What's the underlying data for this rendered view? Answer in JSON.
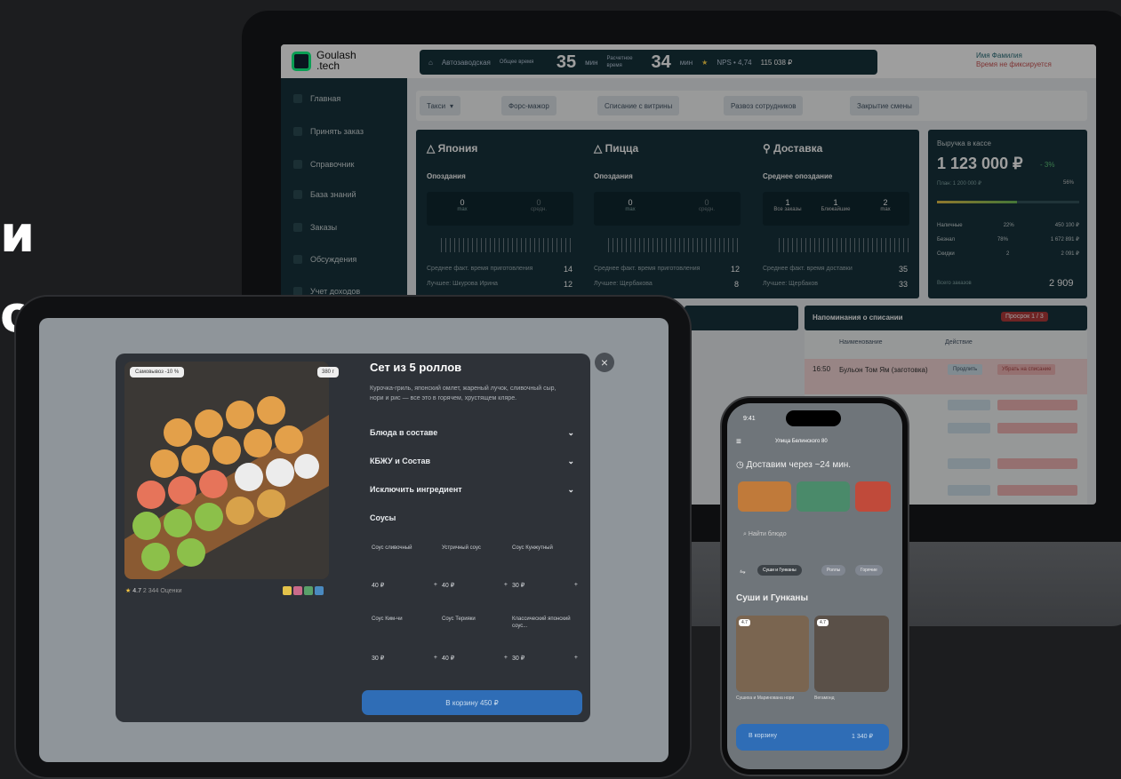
{
  "headline": {
    "line1": "и",
    "line2": "ов"
  },
  "app": {
    "logo_text_1": "Goulash",
    "logo_text_2": ".tech",
    "stats": {
      "location": "Автозаводская",
      "avg_order_label": "Общее время",
      "avg_order_value": "35",
      "avg_order_unit": "мин",
      "cook_label": "Расчетное время",
      "cook_value": "34",
      "cook_unit": "мин",
      "nps": "NPS • 4,74",
      "revenue": "115 038 ₽"
    },
    "user": {
      "name": "Имя Фамилия",
      "status": "Время не фиксируется"
    },
    "sidebar": [
      "Главная",
      "Принять заказ",
      "Справочник",
      "База знаний",
      "Заказы",
      "Обсуждения",
      "Учет доходов"
    ],
    "toolbar": [
      "Такси",
      "Форс-мажор",
      "Списание с витрины",
      "Развоз сотрудников",
      "Закрытие смены"
    ],
    "panels": [
      {
        "title": "Япония",
        "sub": "Опоздания",
        "stats": [
          {
            "v": "0",
            "l": "max"
          },
          {
            "v": "0",
            "l": "средн."
          }
        ],
        "row1_label": "Среднее факт. время приготовления",
        "row1_value": "14",
        "row2_label": "Лучшее: Шкурова Ирина",
        "row2_value": "12"
      },
      {
        "title": "Пицца",
        "sub": "Опоздания",
        "stats": [
          {
            "v": "0",
            "l": "max"
          },
          {
            "v": "0",
            "l": "средн."
          }
        ],
        "row1_label": "Среднее факт. время приготовления",
        "row1_value": "12",
        "row2_label": "Лучшее: Щербакова",
        "row2_value": "8"
      },
      {
        "title": "Доставка",
        "sub": "Среднее опоздание",
        "stats": [
          {
            "v": "1",
            "l": "Все заказы"
          },
          {
            "v": "1",
            "l": "Ближайшие"
          },
          {
            "v": "2",
            "l": "max"
          }
        ],
        "row1_label": "Среднее факт. время доставки",
        "row1_value": "35",
        "row2_label": "Лучшее: Щербаков",
        "row2_value": "33"
      }
    ],
    "cash": {
      "label": "Выручка в кассе",
      "value": "1 123 000 ₽",
      "delta": "- 3%",
      "plan": "План: 1 200 000 ₽",
      "plan_pct": "56%",
      "rows": [
        {
          "l": "Наличные",
          "p": "22%",
          "v": "450 100 ₽"
        },
        {
          "l": "Безнал",
          "p": "78%",
          "v": "1 672 891 ₽"
        },
        {
          "l": "Скидки",
          "p": "2",
          "v": "2 091 ₽"
        }
      ],
      "orders_label": "Всего заказов",
      "orders_value": "2 909"
    },
    "reminders": {
      "title": "Напоминания о списании",
      "badge": "Просрок 1 / 3",
      "col_name": "Наименование",
      "col_action": "Действие",
      "row_time": "16:50",
      "row_name": "Бульон Том Ям (заготовка)",
      "btn_extend": "Продлить",
      "btn_writeoff": "Убрать на списание"
    }
  },
  "modal": {
    "badge_discount": "Самовывоз -10 %",
    "badge_weight": "380 г",
    "title": "Сет из 5 роллов",
    "description": "Курочка-гриль, японский омлет, жареный лучок, сливочный сыр, нори и рис — все это в горячем, хрустящем кляре.",
    "rating": "4.7",
    "reviews": "2 344 Оценки",
    "sections": [
      "Блюда в составе",
      "КБЖУ и Состав",
      "Исключить ингредиент"
    ],
    "sauces_title": "Соусы",
    "sauces": [
      {
        "name": "Соус сливочный",
        "price": "40 ₽"
      },
      {
        "name": "Устричный соус",
        "price": "40 ₽"
      },
      {
        "name": "Соус Кунжутный",
        "price": "30 ₽"
      },
      {
        "name": "Соус Ким-чи",
        "price": "30 ₽"
      },
      {
        "name": "Соус Терияки",
        "price": "40 ₽"
      },
      {
        "name": "Классический японский соус...",
        "price": "30 ₽"
      }
    ],
    "cta": "В корзину 450 ₽",
    "close": "×"
  },
  "phone": {
    "time": "9:41",
    "address": "Улица Белинского 80",
    "delivery": "Доставим через ~24 мин.",
    "search_placeholder": "Найти блюдо",
    "tabs": [
      "Суши и Гунканы",
      "Роллы",
      "Горячие"
    ],
    "section": "Суши и Гунканы",
    "products": [
      {
        "name": "Сушиха и Маринована нори",
        "rating": "4.7"
      },
      {
        "name": "Вегамонд",
        "rating": "4.7"
      }
    ],
    "cart_label": "В корзину",
    "cart_price": "1 340 ₽"
  }
}
